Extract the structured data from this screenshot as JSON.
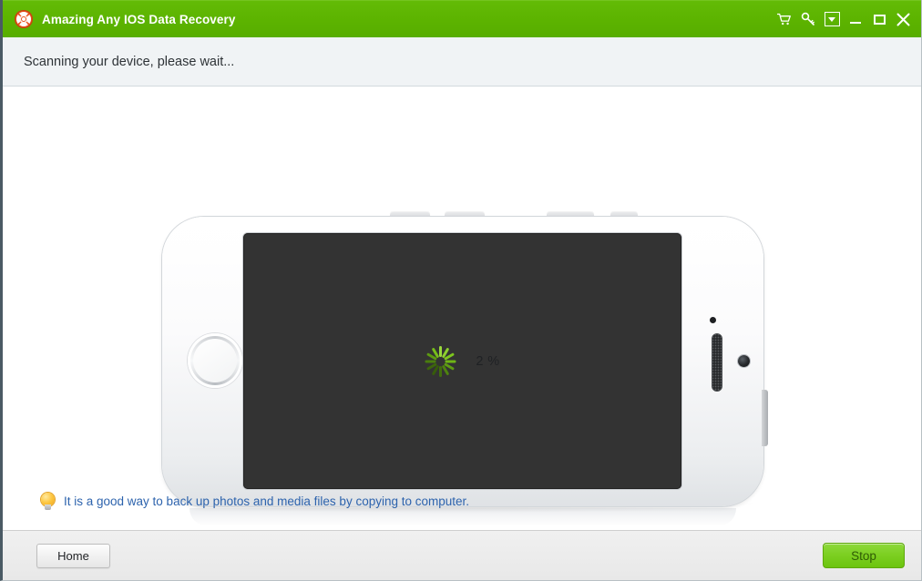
{
  "window": {
    "title": "Amazing Any IOS Data Recovery",
    "app_icon": "lifebuoy-icon",
    "accent_color": "#5cb300",
    "titlebar_text_color": "#ffffff"
  },
  "titlebar_buttons": [
    {
      "name": "cart-icon",
      "label": "Buy"
    },
    {
      "name": "key-icon",
      "label": "Register"
    },
    {
      "name": "menu-dropdown-icon",
      "label": "Menu"
    },
    {
      "name": "minimize-icon",
      "label": "Minimize"
    },
    {
      "name": "maximize-icon",
      "label": "Maximize"
    },
    {
      "name": "close-icon",
      "label": "Close"
    }
  ],
  "status": {
    "text": "Scanning your device, please wait..."
  },
  "scan": {
    "percent_label": "2 %",
    "percent_value": 2,
    "spinner_color": "#7ec61e",
    "device": "iphone-landscape",
    "screen_color": "#333333"
  },
  "tip": {
    "icon": "lightbulb-icon",
    "text": "It is a good way to back up photos and media files by copying to computer.",
    "text_color": "#2d63ad"
  },
  "footer": {
    "home_label": "Home",
    "stop_label": "Stop",
    "stop_color": "#7ccf21"
  }
}
